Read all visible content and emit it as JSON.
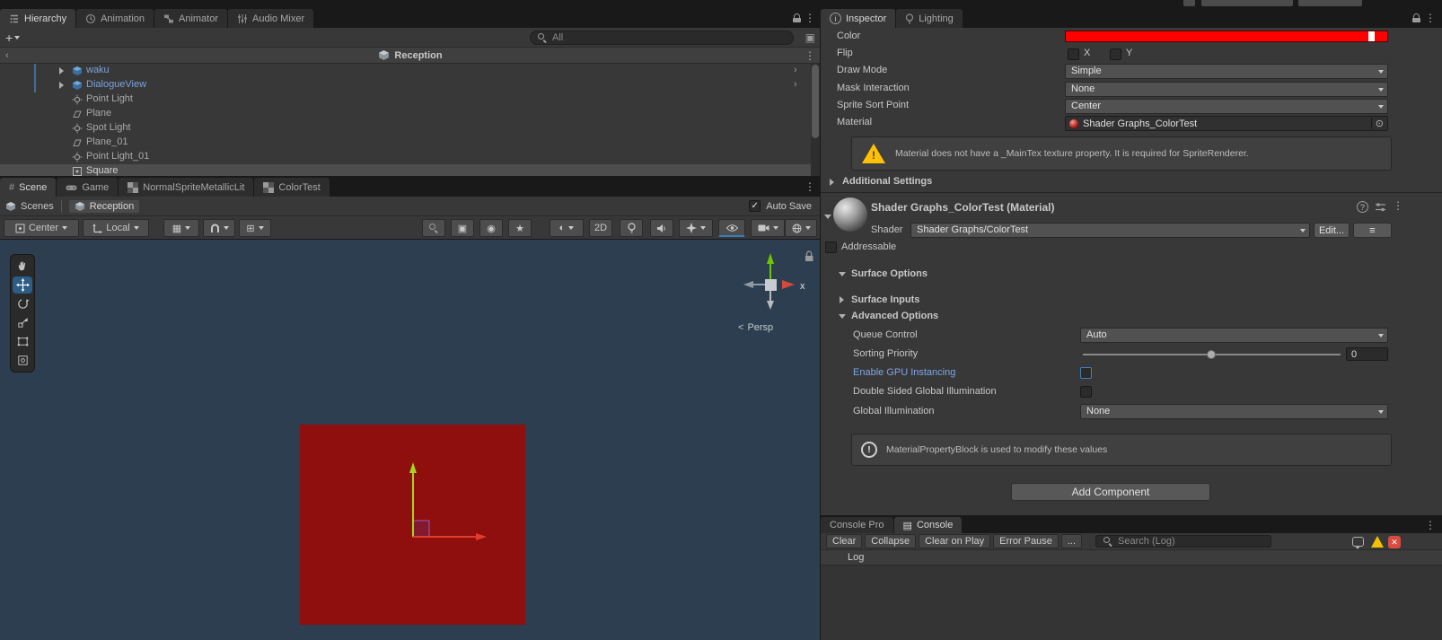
{
  "palette": {
    "selection_blue": "#2c5d87",
    "prefab_text_blue": "#7aa3dc",
    "scene_background": "#2c3e50",
    "quad_red": "#8f0e0e",
    "color_field_value": "#ff0000",
    "warning_yellow": "#ffc107",
    "error_red": "#d84b40"
  },
  "icons": {
    "kebab": "⋮",
    "plus": "+",
    "check": "✓",
    "star": "★",
    "hash": "#",
    "chevron_left": "‹",
    "chevron_right": "›",
    "menu_lines": "≡",
    "question": "?",
    "info": "i",
    "exclaim": "!",
    "close": "✕",
    "grid": "▦",
    "snap_grid": "⊞",
    "lines_box": "▤",
    "shading_sphere": "◐",
    "persp_chevron": "<",
    "frame": "▣",
    "record": "◉",
    "picker_dot": "⊙"
  },
  "hierarchy_dock": {
    "tabs": [
      {
        "label": "Hierarchy"
      },
      {
        "label": "Animation"
      },
      {
        "label": "Animator"
      },
      {
        "label": "Audio Mixer"
      }
    ],
    "search": {
      "placeholder": "All"
    },
    "scene_row": {
      "name": "Reception"
    },
    "items": [
      {
        "label": "waku"
      },
      {
        "label": "DialogueView"
      },
      {
        "label": "Point Light"
      },
      {
        "label": "Plane"
      },
      {
        "label": "Spot Light"
      },
      {
        "label": "Plane_01"
      },
      {
        "label": "Point Light_01"
      },
      {
        "label": "Square"
      }
    ]
  },
  "scene_dock": {
    "tabs": [
      {
        "label": "Scene"
      },
      {
        "label": "Game"
      },
      {
        "label": "NormalSpriteMetallicLit"
      },
      {
        "label": "ColorTest"
      }
    ],
    "breadcrumb": {
      "root": "Scenes",
      "current": "Reception"
    },
    "auto_save_label": "Auto Save",
    "toolbar": {
      "pivot": "Center",
      "orientation": "Local",
      "mode_2d": "2D"
    },
    "viewport": {
      "persp_label": "Persp",
      "axis_x_label": "x"
    }
  },
  "inspector": {
    "tabs": [
      {
        "label": "Inspector"
      },
      {
        "label": "Lighting"
      }
    ],
    "sprite_renderer": {
      "color_label": "Color",
      "flip_label": "Flip",
      "flip_x": "X",
      "flip_y": "Y",
      "draw_mode_label": "Draw Mode",
      "draw_mode_value": "Simple",
      "mask_interaction_label": "Mask Interaction",
      "mask_interaction_value": "None",
      "sprite_sort_point_label": "Sprite Sort Point",
      "sprite_sort_point_value": "Center",
      "material_label": "Material",
      "material_value": "Shader Graphs_ColorTest"
    },
    "warning_text": "Material does not have a _MainTex texture property. It is required for SpriteRenderer.",
    "additional_settings_label": "Additional Settings",
    "material_section": {
      "title": "Shader Graphs_ColorTest (Material)",
      "shader_label": "Shader",
      "shader_value": "Shader Graphs/ColorTest",
      "edit_button": "Edit...",
      "addressable_label": "Addressable",
      "surface_options_label": "Surface Options",
      "surface_inputs_label": "Surface Inputs",
      "advanced_options_label": "Advanced Options",
      "queue_control_label": "Queue Control",
      "queue_control_value": "Auto",
      "sorting_priority_label": "Sorting Priority",
      "sorting_priority_value": "0",
      "gpu_instancing_label": "Enable GPU Instancing",
      "double_sided_gi_label": "Double Sided Global Illumination",
      "global_illumination_label": "Global Illumination",
      "global_illumination_value": "None",
      "info_text": "MaterialPropertyBlock is used to modify these values"
    },
    "add_component_label": "Add Component"
  },
  "console": {
    "tabs": [
      {
        "label": "Console Pro"
      },
      {
        "label": "Console"
      }
    ],
    "buttons": [
      {
        "label": "Clear"
      },
      {
        "label": "Collapse"
      },
      {
        "label": "Clear on Play"
      },
      {
        "label": "Error Pause"
      },
      {
        "label": "..."
      }
    ],
    "search": {
      "placeholder": "Search (Log)"
    },
    "log_column_header": "Log"
  }
}
